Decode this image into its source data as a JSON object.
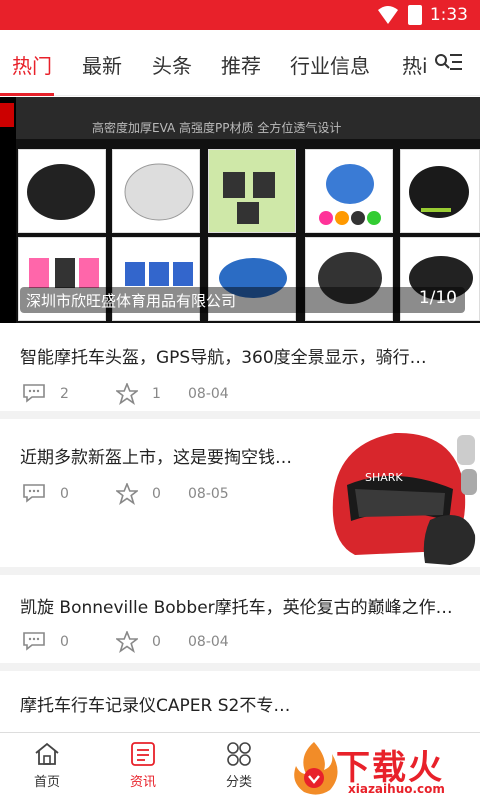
{
  "status": {
    "time": "1:33"
  },
  "tabs": [
    {
      "label": "热门",
      "active": true
    },
    {
      "label": "最新"
    },
    {
      "label": "头条"
    },
    {
      "label": "推荐"
    },
    {
      "label": "行业信息"
    },
    {
      "label": "热i"
    }
  ],
  "banner": {
    "tagline": "高密度加厚EVA   高强度PP材质   全方位透气设计",
    "caption": "深圳市欣旺盛体育用品有限公司",
    "page": "1/10"
  },
  "articles": [
    {
      "title": "智能摩托车头盔，GPS导航，360度全景显示，骑行…",
      "comments": "2",
      "likes": "1",
      "date": "08-04"
    },
    {
      "title": "近期多款新盔上市，这是要掏空钱…",
      "comments": "0",
      "likes": "0",
      "date": "08-05"
    },
    {
      "title": "凯旋 Bonneville Bobber摩托车，英伦复古的巅峰之作…",
      "comments": "0",
      "likes": "0",
      "date": "08-04"
    },
    {
      "title": "摩托车行车记录仪CAPER S2不专…"
    }
  ],
  "bottom_nav": [
    {
      "label": "首页",
      "icon": "home-icon"
    },
    {
      "label": "资讯",
      "icon": "news-icon",
      "active": true
    },
    {
      "label": "分类",
      "icon": "category-icon"
    }
  ],
  "watermark": {
    "text": "下载火",
    "sub": "xiazaihuo.com"
  },
  "colors": {
    "accent": "#e8212a"
  }
}
